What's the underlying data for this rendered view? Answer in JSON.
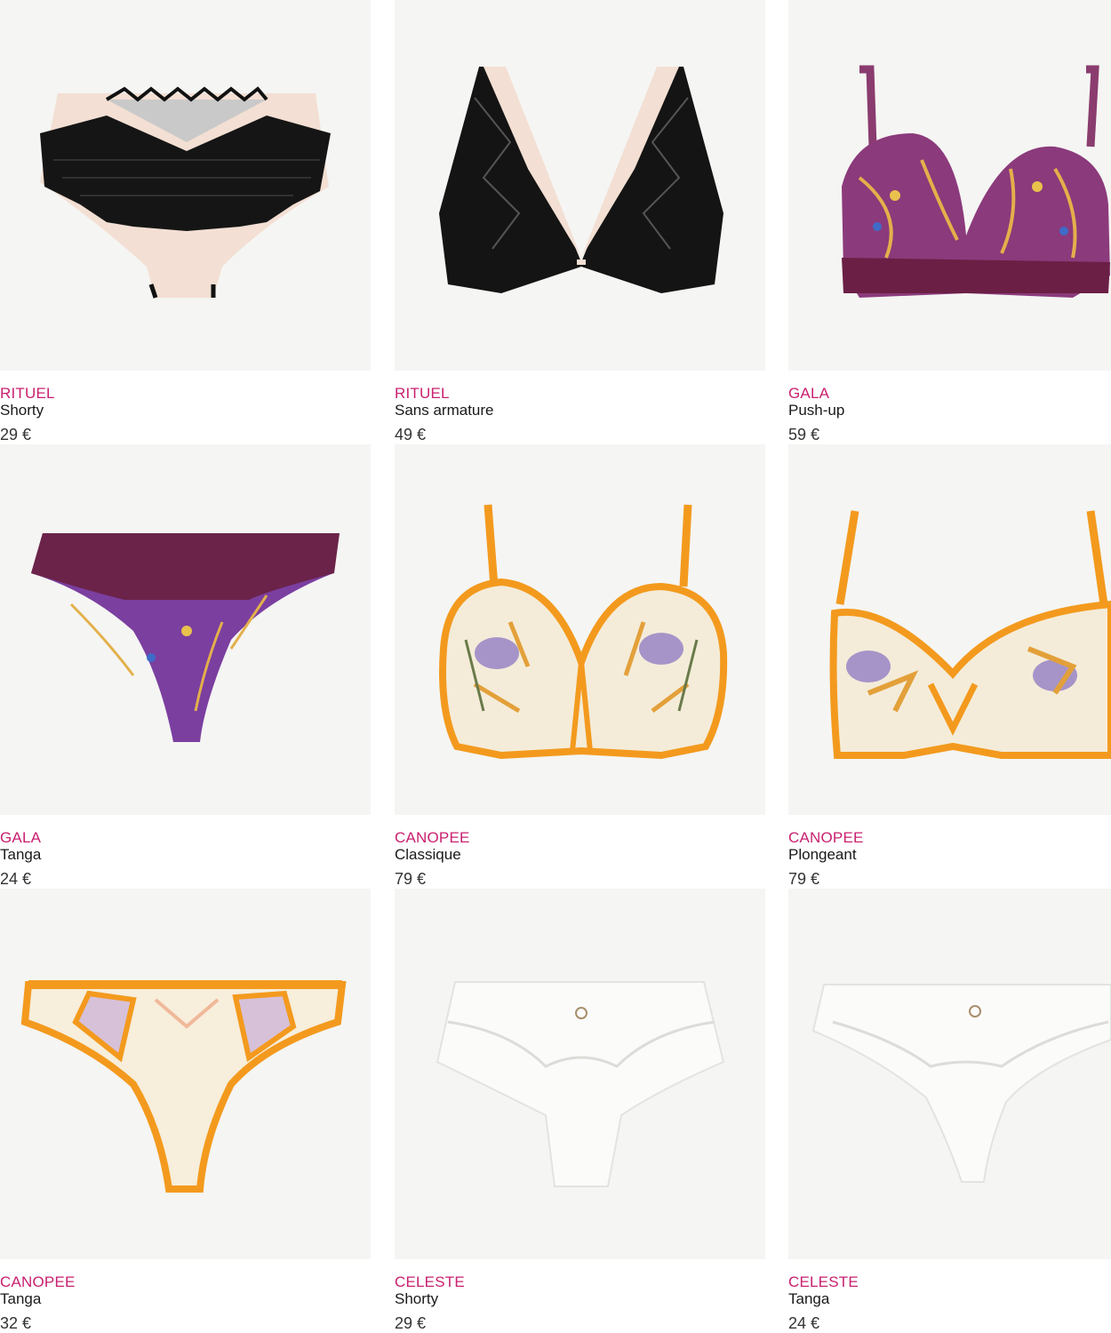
{
  "products": [
    {
      "brand": "RITUEL",
      "name": "Shorty",
      "price": "29 €",
      "image": "black-lace-shorty-image",
      "colors": [
        "#111111",
        "#f3dfd3"
      ]
    },
    {
      "brand": "RITUEL",
      "name": "Sans armature",
      "price": "49 €",
      "image": "black-lace-bralette-image",
      "colors": [
        "#111111",
        "#f3dfd3"
      ]
    },
    {
      "brand": "GALA",
      "name": "Push-up",
      "price": "59 €",
      "image": "purple-print-push-up-bra-image",
      "colors": [
        "#7a2a5e",
        "#e3b04b"
      ]
    },
    {
      "brand": "GALA",
      "name": "Tanga",
      "price": "24 €",
      "image": "purple-print-tanga-image",
      "colors": [
        "#6b2349",
        "#7b3fa0"
      ]
    },
    {
      "brand": "CANOPEE",
      "name": "Classique",
      "price": "79 €",
      "image": "floral-embroidered-bra-image",
      "colors": [
        "#f39a1e",
        "#f4ecd9"
      ]
    },
    {
      "brand": "CANOPEE",
      "name": "Plongeant",
      "price": "79 €",
      "image": "floral-plunge-bra-image",
      "colors": [
        "#f39a1e",
        "#f4ecd9"
      ]
    },
    {
      "brand": "CANOPEE",
      "name": "Tanga",
      "price": "32 €",
      "image": "orange-trim-tanga-image",
      "colors": [
        "#f39a1e",
        "#f7eedb"
      ]
    },
    {
      "brand": "CELESTE",
      "name": "Shorty",
      "price": "29 €",
      "image": "white-lace-shorty-image",
      "colors": [
        "#f4f4f2",
        "#e6e6e3"
      ]
    },
    {
      "brand": "CELESTE",
      "name": "Tanga",
      "price": "24 €",
      "image": "white-lace-tanga-image",
      "colors": [
        "#f4f4f2",
        "#e6e6e3"
      ]
    }
  ]
}
